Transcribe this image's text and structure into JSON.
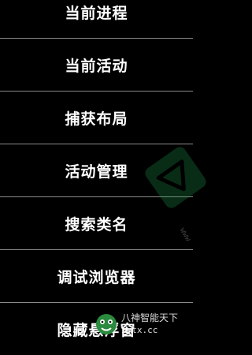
{
  "menu": {
    "items": [
      {
        "label": "当前进程"
      },
      {
        "label": "当前活动"
      },
      {
        "label": "捕获布局"
      },
      {
        "label": "活动管理"
      },
      {
        "label": "搜索类名"
      },
      {
        "label": "调试浏览器"
      },
      {
        "label": "隐藏悬浮窗"
      }
    ]
  },
  "watermark": {
    "side_text": "www",
    "title": "八神智能天下",
    "url": "zmtx.cc"
  },
  "colors": {
    "background": "#000000",
    "text": "#ffffff",
    "divider": "#8a8a8a",
    "watermark_green": "#1f9d4f"
  }
}
